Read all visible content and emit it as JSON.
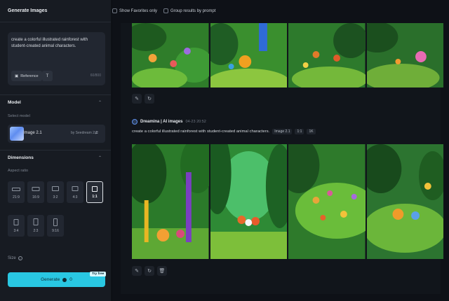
{
  "sidebar": {
    "title": "Generate Images",
    "prompt": "create a colorful illustrated rainforest with student-created animal characters.",
    "reference_label": "Reference",
    "t_label": "T",
    "counter": "60/800",
    "model_section": "Model",
    "select_model_label": "Select model",
    "model_name": "Image 2.1",
    "model_by": "by Seedream 2.1",
    "dimensions_section": "Dimensions",
    "aspect_label": "Aspect ratio",
    "ratios": [
      "21:9",
      "16:9",
      "3:2",
      "4:3",
      "1:1",
      "3:4",
      "2:3",
      "9:16"
    ],
    "selected_ratio": "1:1",
    "size_label": "Size",
    "generate_label": "Generate",
    "generate_cost": "0",
    "try_free": "Try free"
  },
  "topbar": {
    "favorites_label": "Show Favorites only",
    "group_label": "Group results by prompt"
  },
  "result": {
    "author": "Dreamina | AI images",
    "timestamp": "04-23 20:52",
    "prompt": "create a colorful illustrated rainforest with student-created animal characters.",
    "tags": [
      "Image 2.1",
      "1:1",
      "1K"
    ]
  },
  "colors": {
    "accent": "#29c7e2",
    "background": "#0e1117",
    "panel": "#171b22"
  }
}
